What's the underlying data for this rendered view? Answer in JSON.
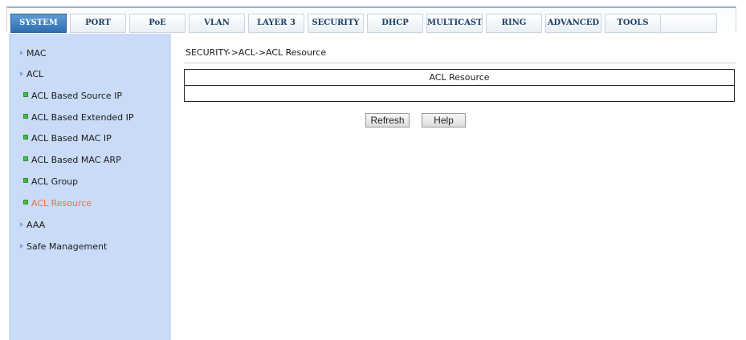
{
  "nav": {
    "tabs": [
      {
        "label": "SYSTEM"
      },
      {
        "label": "PORT"
      },
      {
        "label": "PoE"
      },
      {
        "label": "VLAN"
      },
      {
        "label": "LAYER 3"
      },
      {
        "label": "SECURITY"
      },
      {
        "label": "DHCP"
      },
      {
        "label": "MULTICAST"
      },
      {
        "label": "RING"
      },
      {
        "label": "ADVANCED"
      },
      {
        "label": "TOOLS"
      }
    ],
    "active_tab": "SYSTEM"
  },
  "sidebar": {
    "items": [
      {
        "label": "MAC",
        "level": 1
      },
      {
        "label": "ACL",
        "level": 1
      },
      {
        "label": "ACL Based Source IP",
        "level": 2
      },
      {
        "label": "ACL Based Extended IP",
        "level": 2
      },
      {
        "label": "ACL Based MAC IP",
        "level": 2
      },
      {
        "label": "ACL Based MAC ARP",
        "level": 2
      },
      {
        "label": "ACL Group",
        "level": 2
      },
      {
        "label": "ACL Resource",
        "level": 2,
        "current": true
      },
      {
        "label": "AAA",
        "level": 1
      },
      {
        "label": "Safe Management",
        "level": 1
      }
    ]
  },
  "main": {
    "breadcrumb": "SECURITY->ACL->ACL Resource",
    "table_header": "ACL Resource",
    "table_value": ""
  },
  "buttons": {
    "refresh_label": "Refresh",
    "help_label": "Help"
  },
  "colors": {
    "sidebar_bg": "#c9dbf6",
    "active_tab": "#2f6fb0",
    "current_item": "#e8744a",
    "bullet": "#47b94a"
  }
}
